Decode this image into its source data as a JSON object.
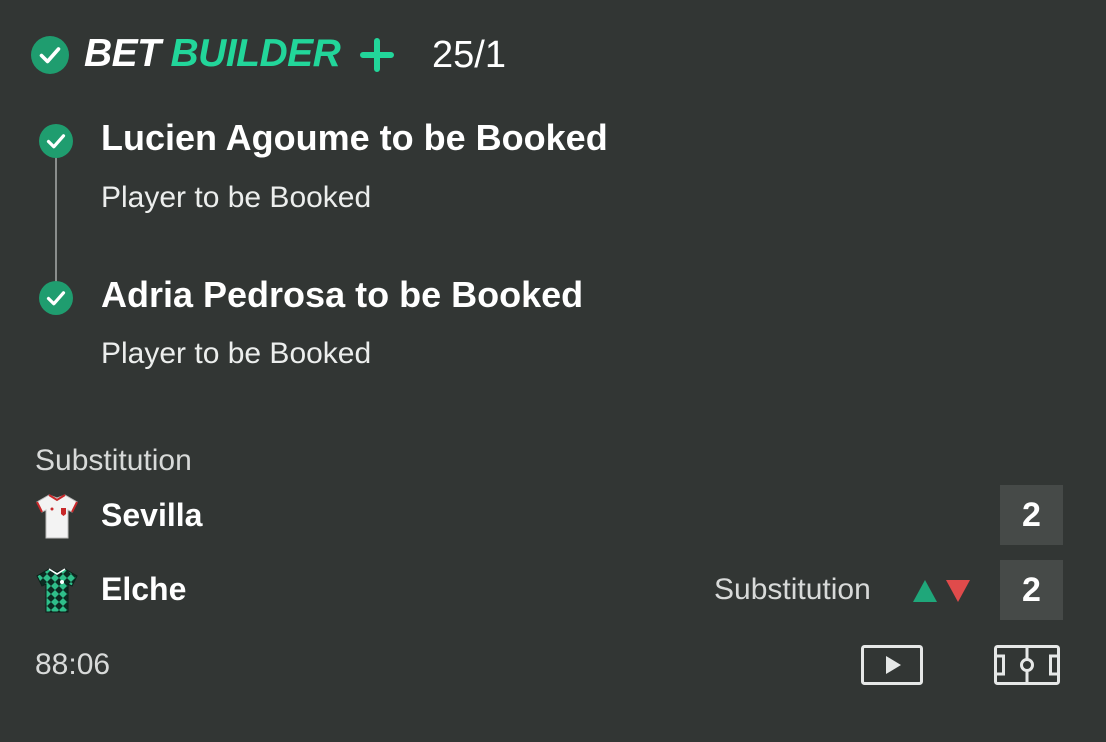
{
  "header": {
    "check_icon": "check-circle-icon",
    "brand_part1": "BET",
    "brand_part2": "BUILDER",
    "brand_plus_icon": "plus-icon",
    "odds": "25/1",
    "accent_color": "#22d69a"
  },
  "selections": [
    {
      "icon": "check-circle-icon",
      "title": "Lucien Agoume to be Booked",
      "market": "Player to be Booked"
    },
    {
      "icon": "check-circle-icon",
      "title": "Adria Pedrosa to be Booked",
      "market": "Player to be Booked"
    }
  ],
  "scoreboard": {
    "status_label": "Substitution",
    "teams": [
      {
        "name": "Sevilla",
        "shirt_icon": "sevilla-shirt-icon",
        "score": "2",
        "event": ""
      },
      {
        "name": "Elche",
        "shirt_icon": "elche-shirt-icon",
        "score": "2",
        "event": "Substitution",
        "event_icon": "substitution-arrows-icon"
      }
    ],
    "match_time": "88:06",
    "actions": {
      "video_icon": "play-video-icon",
      "pitch_icon": "pitch-tracker-icon"
    }
  },
  "colors": {
    "background": "#323634",
    "accent": "#22d69a",
    "check_fill": "#1f9d6f",
    "score_box": "#464a48",
    "sub_in": "#1fa77a",
    "sub_out": "#e04b4b"
  }
}
